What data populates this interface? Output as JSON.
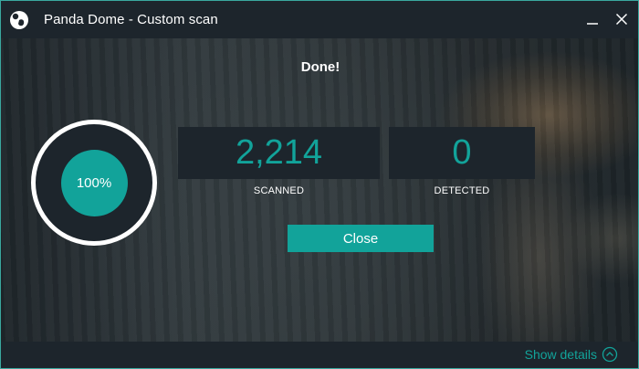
{
  "window": {
    "title": "Panda Dome - Custom scan",
    "logo_icon": "panda-logo-icon",
    "controls": {
      "minimize_icon": "minimize-icon",
      "close_icon": "close-icon"
    }
  },
  "status": {
    "heading": "Done!"
  },
  "progress": {
    "label": "100%",
    "percent": 100
  },
  "stats": {
    "scanned": {
      "value": "2,214",
      "label": "SCANNED"
    },
    "detected": {
      "value": "0",
      "label": "DETECTED"
    }
  },
  "actions": {
    "close_label": "Close"
  },
  "footer": {
    "show_details_label": "Show details",
    "chevron_icon": "chevron-up-circle-icon"
  },
  "colors": {
    "accent": "#12a39a",
    "panel": "#1d252c",
    "text": "#ffffff",
    "ring": "#ffffff"
  }
}
